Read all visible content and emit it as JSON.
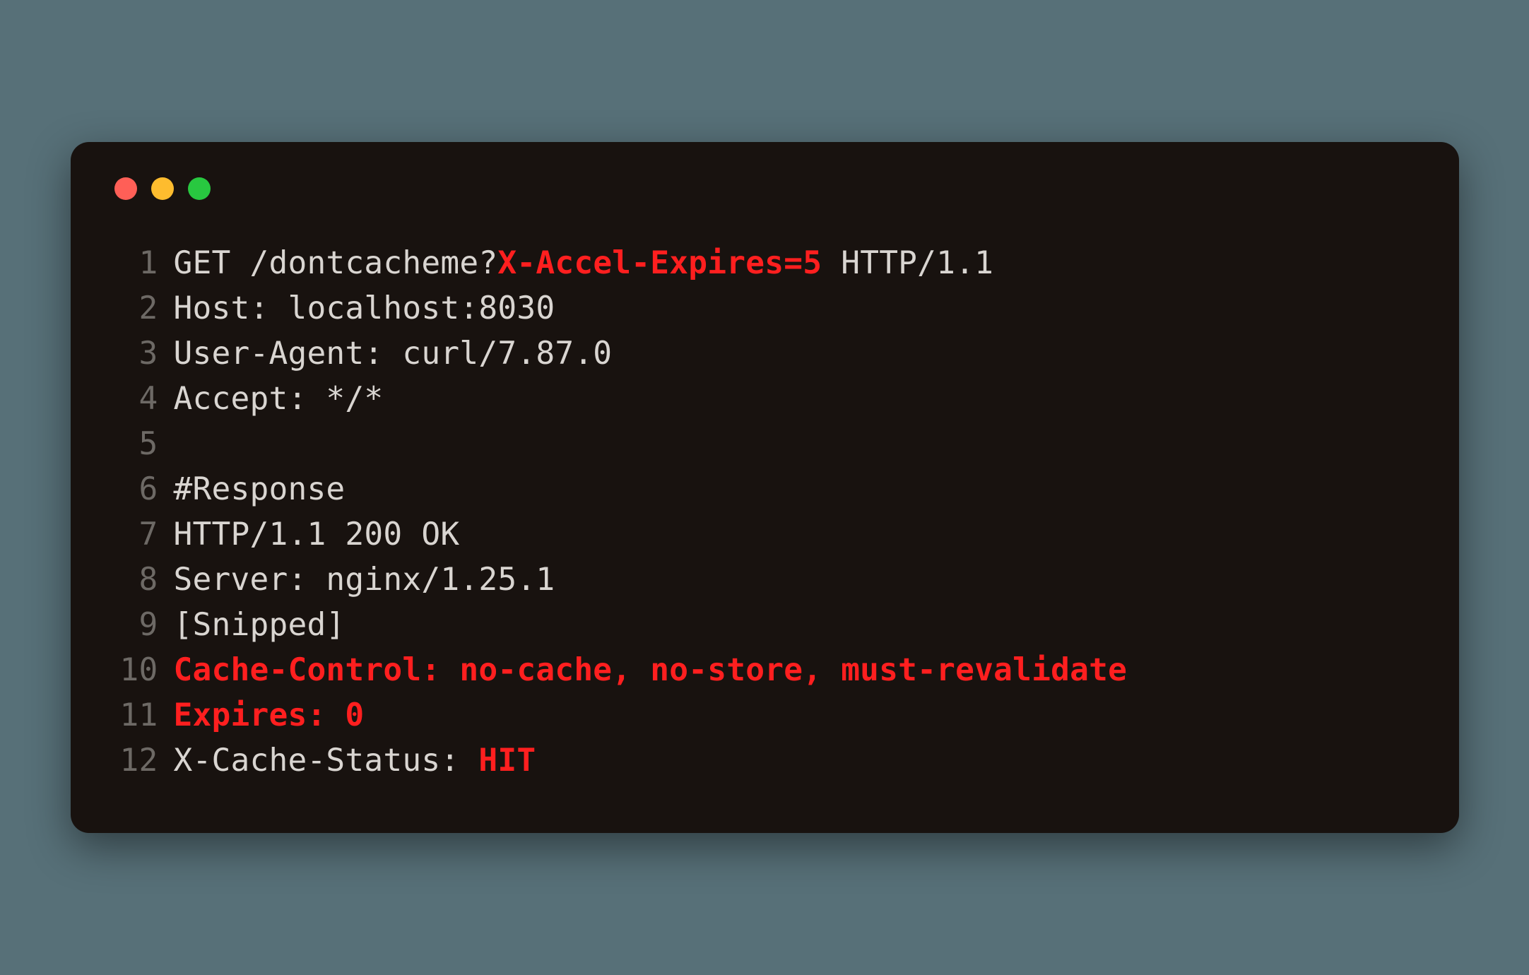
{
  "lines": [
    {
      "num": "1",
      "segments": [
        {
          "t": "GET /dontcacheme?",
          "hl": false
        },
        {
          "t": "X-Accel-Expires=5",
          "hl": true
        },
        {
          "t": " HTTP/1.1",
          "hl": false
        }
      ]
    },
    {
      "num": "2",
      "segments": [
        {
          "t": "Host: localhost:8030",
          "hl": false
        }
      ]
    },
    {
      "num": "3",
      "segments": [
        {
          "t": "User-Agent: curl/7.87.0",
          "hl": false
        }
      ]
    },
    {
      "num": "4",
      "segments": [
        {
          "t": "Accept: */*",
          "hl": false
        }
      ]
    },
    {
      "num": "5",
      "segments": [
        {
          "t": "",
          "hl": false
        }
      ]
    },
    {
      "num": "6",
      "segments": [
        {
          "t": "#Response",
          "hl": false
        }
      ]
    },
    {
      "num": "7",
      "segments": [
        {
          "t": "HTTP/1.1 200 OK",
          "hl": false
        }
      ]
    },
    {
      "num": "8",
      "segments": [
        {
          "t": "Server: nginx/1.25.1",
          "hl": false
        }
      ]
    },
    {
      "num": "9",
      "segments": [
        {
          "t": "[Snipped]",
          "hl": false
        }
      ]
    },
    {
      "num": "10",
      "segments": [
        {
          "t": "Cache-Control: no-cache, no-store, must-revalidate",
          "hl": true
        }
      ]
    },
    {
      "num": "11",
      "segments": [
        {
          "t": "Expires: 0",
          "hl": true
        }
      ]
    },
    {
      "num": "12",
      "segments": [
        {
          "t": "X-Cache-Status: ",
          "hl": false
        },
        {
          "t": "HIT",
          "hl": true
        }
      ]
    }
  ],
  "colors": {
    "bg_page": "#577078",
    "bg_terminal": "#18120f",
    "text": "#d9d5d1",
    "lineno": "#6d6965",
    "highlight": "#ff1f1f",
    "red": "#ff5f57",
    "yellow": "#febc2e",
    "green": "#28c840"
  }
}
